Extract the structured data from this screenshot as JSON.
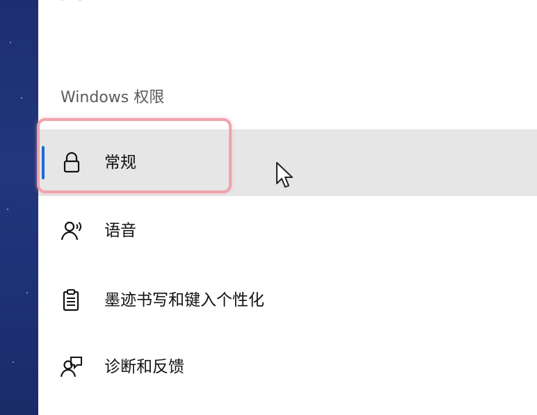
{
  "header": {
    "cut_title": "隐私"
  },
  "section": {
    "title": "Windows 权限"
  },
  "nav": {
    "items": [
      {
        "label": "常规",
        "icon": "lock-icon",
        "selected": true
      },
      {
        "label": "语音",
        "icon": "speech-person-icon",
        "selected": false
      },
      {
        "label": "墨迹书写和键入个性化",
        "icon": "clipboard-checklist-icon",
        "selected": false
      },
      {
        "label": "诊断和反馈",
        "icon": "feedback-person-icon",
        "selected": false
      }
    ]
  },
  "colors": {
    "accent": "#1a6bd6",
    "selected_background": "#e6e6e6",
    "highlight_ring": "#f0a3ac",
    "desktop_background": "#1f3275"
  }
}
